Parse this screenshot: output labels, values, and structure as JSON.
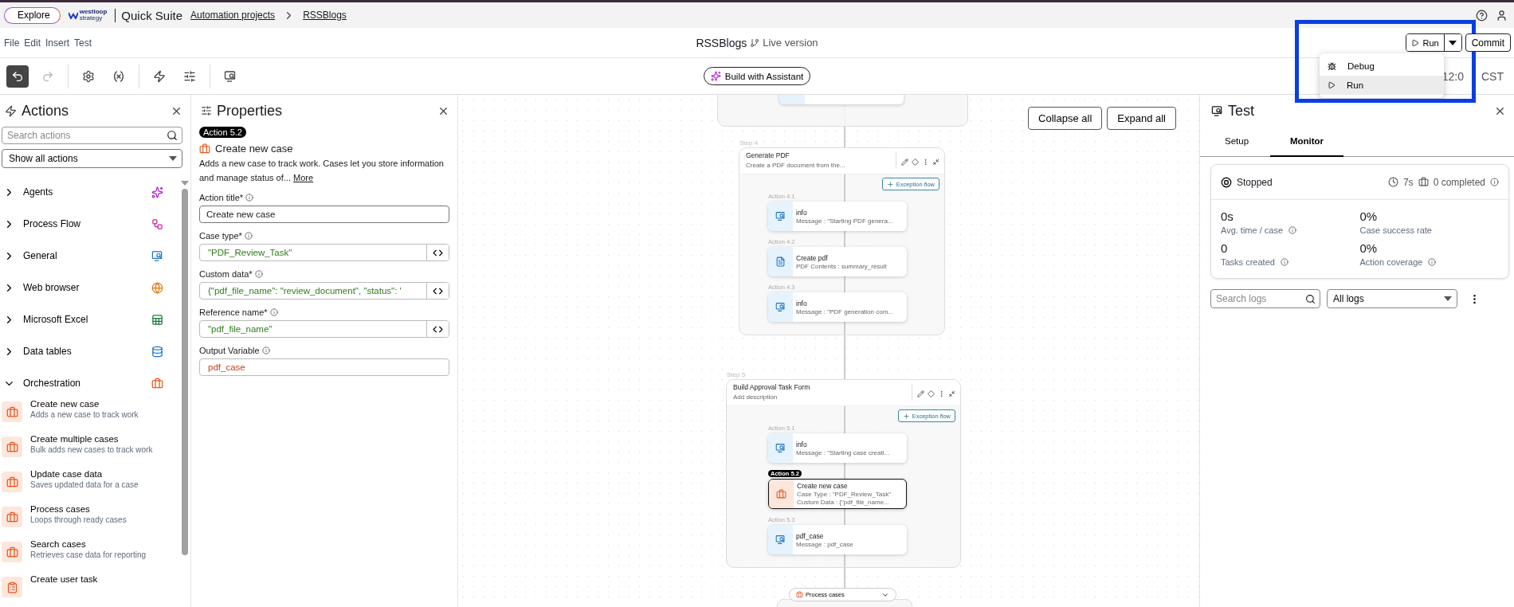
{
  "top_bar": {
    "explore": "Explore",
    "logo": [
      "westloop",
      "strategy"
    ],
    "app_name": "Quick Suite",
    "breadcrumbs": [
      "Automation projects",
      "RSSBlogs"
    ]
  },
  "menu": [
    "File",
    "Edit",
    "Insert",
    "Test"
  ],
  "document": {
    "title": "RSSBlogs",
    "version": "Live version"
  },
  "toolbar": {
    "assistant": "Build with Assistant",
    "time": [
      "12:0",
      "CST"
    ]
  },
  "run_button": "Run",
  "commit_button": "Commit",
  "run_menu": [
    {
      "label": "Debug",
      "kind": "debug",
      "selected": false
    },
    {
      "label": "Run",
      "kind": "run",
      "selected": true
    }
  ],
  "actions_panel": {
    "title": "Actions",
    "search_placeholder": "Search actions",
    "filter": "Show all actions",
    "categories": [
      {
        "label": "Agents",
        "kind": "agents",
        "expanded": false
      },
      {
        "label": "Process Flow",
        "kind": "flow",
        "expanded": false
      },
      {
        "label": "General",
        "kind": "general",
        "expanded": false
      },
      {
        "label": "Web browser",
        "kind": "web",
        "expanded": false
      },
      {
        "label": "Microsoft Excel",
        "kind": "excel",
        "expanded": false
      },
      {
        "label": "Data tables",
        "kind": "tables",
        "expanded": false
      },
      {
        "label": "Orchestration",
        "kind": "orchestration",
        "expanded": true
      }
    ],
    "items": [
      {
        "title": "Create new case",
        "description": "Adds a new case to track work",
        "kind": "case"
      },
      {
        "title": "Create multiple cases",
        "description": "Bulk adds new cases to track work",
        "kind": "case"
      },
      {
        "title": "Update case data",
        "description": "Saves updated data for a case",
        "kind": "case"
      },
      {
        "title": "Process cases",
        "description": "Loops through ready cases",
        "kind": "case"
      },
      {
        "title": "Search cases",
        "description": "Retrieves case data for reporting",
        "kind": "case"
      },
      {
        "title": "Create user task",
        "kind": "task"
      }
    ]
  },
  "properties": {
    "title": "Properties",
    "badge": "Action 5.2",
    "action_name": "Create new case",
    "description": "Adds a new case to track work. Cases let you store information and manage status of...",
    "more": "More",
    "fields": [
      {
        "label": "Action title*",
        "value": "Create new case",
        "kind": "plain"
      },
      {
        "label": "Case type*",
        "value": "\"PDF_Review_Task\"",
        "kind": "code"
      },
      {
        "label": "Custom data*",
        "value": "{\"pdf_file_name\": \"review_document\", \"status\": '",
        "kind": "code"
      },
      {
        "label": "Reference name*",
        "value": "\"pdf_file_name\"",
        "kind": "code"
      },
      {
        "label": "Output Variable",
        "value": "pdf_case",
        "kind": "variable"
      }
    ]
  },
  "canvas": {
    "collapse": "Collapse all",
    "expand": "Expand all",
    "steps": [
      {
        "label": "Step 4",
        "title": "Generate PDF",
        "description": "Create a PDF document from the...",
        "exception": "Exception flow",
        "actions": [
          {
            "label": "Action 4.1",
            "title": "info",
            "lines": [
              "Message : \"Starting PDF genera..."
            ],
            "kind": "general",
            "selected": false
          },
          {
            "label": "Action 4.2",
            "title": "Create pdf",
            "lines": [
              "PDF Contents : summary_result"
            ],
            "kind": "pdf",
            "selected": false
          },
          {
            "label": "Action 4.3",
            "title": "info",
            "lines": [
              "Message : \"PDF generation com..."
            ],
            "kind": "general",
            "selected": false
          }
        ]
      },
      {
        "label": "Step 5",
        "title": "Build Approval Task Form",
        "description": "Add description",
        "exception": "Exception flow",
        "actions": [
          {
            "label": "Action 5.1",
            "title": "info",
            "lines": [
              "Message : \"Starting case creati..."
            ],
            "kind": "general",
            "selected": false
          },
          {
            "label": "Action 5.2",
            "title": "Create new case",
            "lines": [
              "Case Type : \"PDF_Review_Task\"",
              "Custom Data : {\"pdf_file_name..."
            ],
            "kind": "case",
            "selected": true
          },
          {
            "label": "Action 5.3",
            "title": "pdf_case",
            "lines": [
              "Message : pdf_case"
            ],
            "kind": "general",
            "selected": false
          }
        ]
      }
    ],
    "loop": "Process cases"
  },
  "test_panel": {
    "title": "Test",
    "tabs": [
      {
        "label": "Setup",
        "selected": false
      },
      {
        "label": "Monitor",
        "selected": true
      }
    ],
    "status": "Stopped",
    "duration": "7s",
    "completed": "0 completed",
    "metrics": [
      {
        "value": "0s",
        "label": "Avg. time / case",
        "info": true
      },
      {
        "value": "0%",
        "label": "Case success rate",
        "info": false
      },
      {
        "value": "0",
        "label": "Tasks created",
        "info": true
      },
      {
        "value": "0%",
        "label": "Action coverage",
        "info": true
      }
    ],
    "search_placeholder": "Search logs",
    "filter": "All logs"
  }
}
